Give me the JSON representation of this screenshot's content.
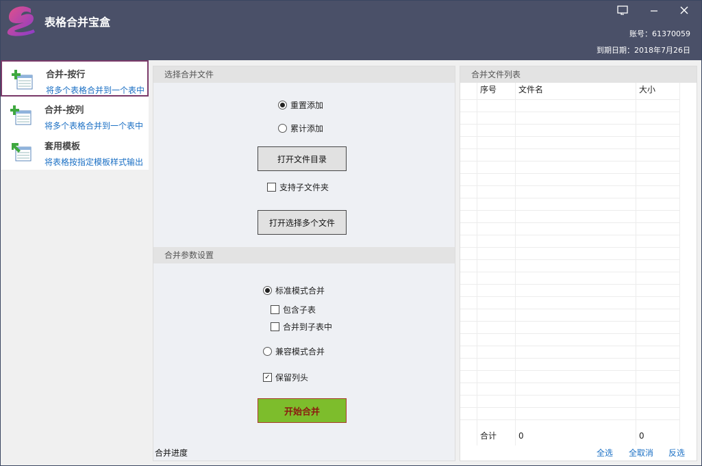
{
  "app": {
    "title": "表格合并宝盒",
    "account": "账号：61370059",
    "expire": "到期日期：2018年7月26日"
  },
  "sidebar": {
    "items": [
      {
        "title": "合并-按行",
        "desc": "将多个表格合并到一个表中",
        "active": true
      },
      {
        "title": "合并-按列",
        "desc": "将多个表格合并到一个表中",
        "active": false
      },
      {
        "title": "套用模板",
        "desc": "将表格按指定模板样式输出",
        "active": false
      }
    ]
  },
  "select_files": {
    "header": "选择合并文件",
    "radio_reset": "重置添加",
    "radio_accumulate": "累计添加",
    "open_dir_btn": "打开文件目录",
    "support_subfolder": "支持子文件夹",
    "open_multi_btn": "打开选择多个文件"
  },
  "params": {
    "header": "合并参数设置",
    "standard_mode": "标准模式合并",
    "include_subsheet": "包含子表",
    "merge_to_subsheet": "合并到子表中",
    "compat_mode": "兼容模式合并",
    "keep_header": "保留列头",
    "start_btn": "开始合并",
    "progress_label": "合并进度"
  },
  "file_list": {
    "header": "合并文件列表",
    "columns": [
      "序号",
      "文件名",
      "大小"
    ],
    "sum_label": "合计",
    "sum_count": "0",
    "sum_size": "0",
    "select_all": "全选",
    "deselect_all": "全取消",
    "invert": "反选"
  }
}
